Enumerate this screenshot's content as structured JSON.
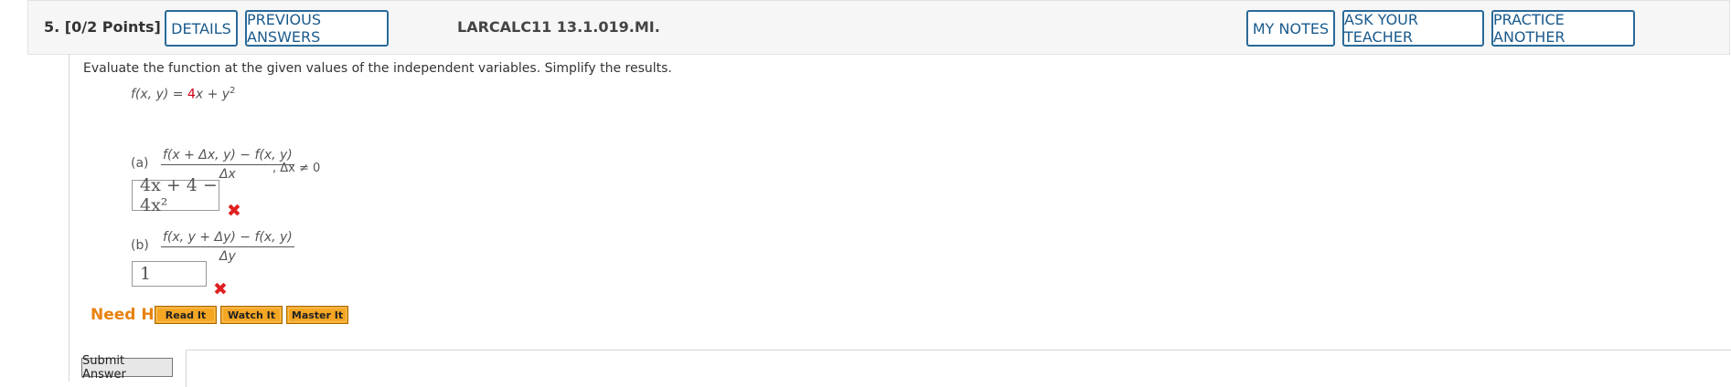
{
  "header": {
    "question_number": "5.",
    "points": "[0/2 Points]",
    "details_label": "DETAILS",
    "previous_answers_label": "PREVIOUS ANSWERS",
    "problem_code": "LARCALC11 13.1.019.MI.",
    "my_notes_label": "MY NOTES",
    "ask_teacher_label": "ASK YOUR TEACHER",
    "practice_another_label": "PRACTICE ANOTHER"
  },
  "question": {
    "prompt": "Evaluate the function at the given values of the independent variables. Simplify the results.",
    "function_lhs": "f(x, y) = ",
    "function_coef": "4",
    "function_rest": "x + y",
    "function_exp": "2",
    "part_a": {
      "label": "(a)",
      "numerator": "f(x + Δx, y) − f(x, y)",
      "denominator": "Δx",
      "answer": "4x + 4 − 4x²",
      "condition": ", Δx ≠ 0",
      "status": "incorrect"
    },
    "part_b": {
      "label": "(b)",
      "numerator": "f(x, y + Δy) − f(x, y)",
      "denominator": "Δy",
      "answer": "1",
      "status": "incorrect"
    }
  },
  "help": {
    "label": "Need Help?",
    "buttons": [
      "Read It",
      "Watch It",
      "Master It"
    ]
  },
  "submit_label": "Submit Answer",
  "icons": {
    "incorrect": "x-mark-icon"
  },
  "colors": {
    "accent": "#1a5a8c",
    "incorrect": "#e02020",
    "help": "#e8820e",
    "help_button": "#f5a623"
  }
}
